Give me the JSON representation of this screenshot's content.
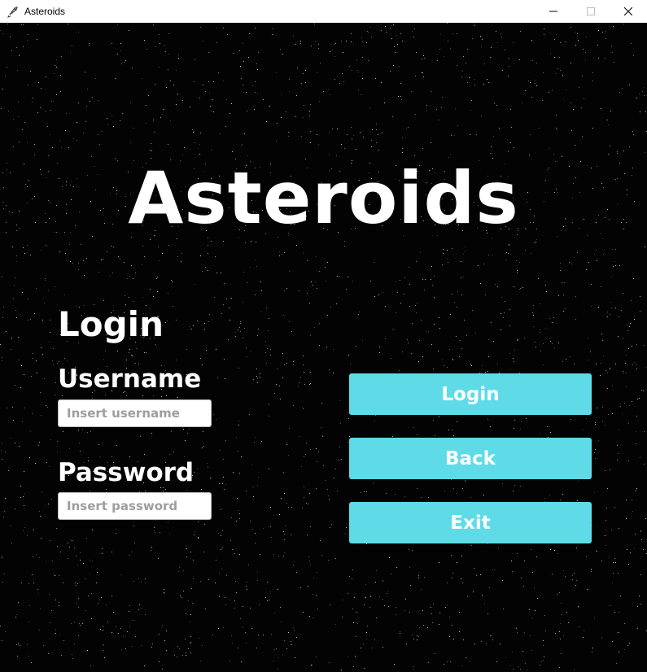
{
  "window": {
    "title": "Asteroids",
    "icon": "rocket-icon",
    "controls": [
      "minimize-icon",
      "maximize-icon",
      "close-icon"
    ]
  },
  "game": {
    "title": "Asteroids",
    "background_color": "#030303",
    "accent_color": "#5fdbe8"
  },
  "login_form": {
    "heading": "Login",
    "username_label": "Username",
    "username_placeholder": "Insert username",
    "username_value": "",
    "password_label": "Password",
    "password_placeholder": "Insert password",
    "password_value": ""
  },
  "buttons": {
    "login_label": "Login",
    "back_label": "Back",
    "exit_label": "Exit"
  }
}
